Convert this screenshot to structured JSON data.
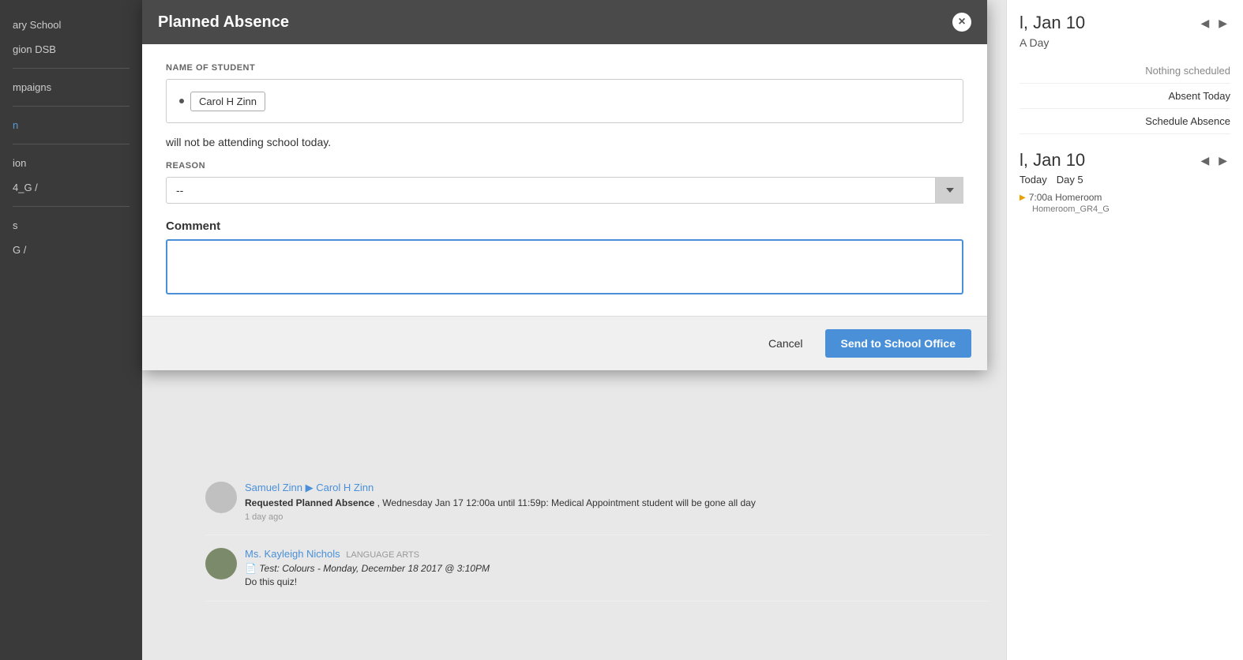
{
  "sidebar": {
    "items": [
      {
        "label": "ary School",
        "blue": false
      },
      {
        "label": "",
        "blue": false
      },
      {
        "label": "gion DSB",
        "blue": false
      },
      {
        "label": "",
        "blue": false
      },
      {
        "label": "mpaigns",
        "blue": false
      },
      {
        "label": "",
        "blue": false
      },
      {
        "label": "n",
        "blue": true
      },
      {
        "label": "",
        "blue": false
      },
      {
        "label": "ion",
        "blue": false
      },
      {
        "label": "4_G /",
        "blue": false
      },
      {
        "label": "",
        "blue": false
      },
      {
        "label": "s",
        "blue": false
      },
      {
        "label": "G /",
        "blue": false
      }
    ]
  },
  "right_panel": {
    "date": "l, Jan 10",
    "day_label": "A Day",
    "nothing_scheduled": "Nothing scheduled",
    "absent_today": "Absent Today",
    "schedule_absence": "Schedule Absence",
    "date2": "l, Jan 10",
    "today_label": "Today",
    "day5_label": "Day 5",
    "homeroom_time": "7:00a Homeroom",
    "homeroom_location": "Homeroom_GR4_G"
  },
  "feed": {
    "item1": {
      "author": "Samuel Zinn",
      "arrow": "▶",
      "recipient": "Carol H Zinn",
      "body_bold": "Requested Planned Absence",
      "body": ", Wednesday Jan 17 12:00a until 11:59p: Medical Appointment student will be gone all day",
      "time": "1 day ago"
    },
    "item2": {
      "author": "Ms. Kayleigh Nichols",
      "subject": "LANGUAGE ARTS",
      "icon": "📄",
      "body": "Test: Colours - Monday, December 18 2017 @ 3:10PM",
      "subtitle": "Do this quiz!"
    }
  },
  "modal": {
    "title": "Planned Absence",
    "close_label": "×",
    "student_label": "NAME OF STUDENT",
    "student_name": "Carol H Zinn",
    "attending_text": "will not be attending school today.",
    "reason_label": "REASON",
    "reason_placeholder": "--",
    "comment_label": "Comment",
    "comment_placeholder": "",
    "cancel_label": "Cancel",
    "send_label": "Send to School Office"
  }
}
